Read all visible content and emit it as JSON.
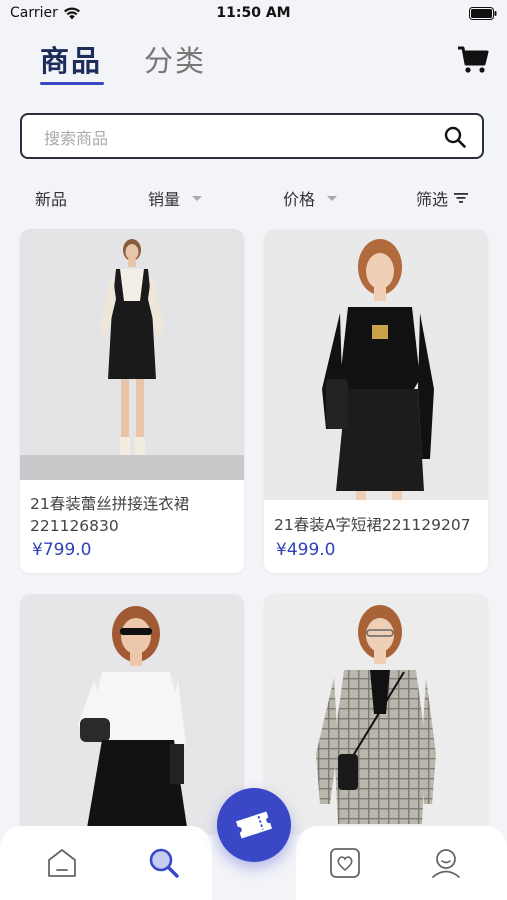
{
  "status_bar": {
    "carrier": "Carrier",
    "time": "11:50 AM"
  },
  "header": {
    "tabs": [
      {
        "label": "商品",
        "active": true
      },
      {
        "label": "分类",
        "active": false
      }
    ],
    "cart_icon": "cart-icon"
  },
  "search": {
    "placeholder": "搜索商品",
    "value": ""
  },
  "filters": [
    {
      "label": "新品"
    },
    {
      "label": "销量",
      "indicator": "caret-down"
    },
    {
      "label": "价格",
      "indicator": "caret-down"
    },
    {
      "label": "筛选",
      "indicator": "filter-icon"
    }
  ],
  "products": [
    {
      "name": "21春装蕾丝拼接连衣裙221126830",
      "price": "¥799.0"
    },
    {
      "name": "21春装A字短裙221129207",
      "price": "¥499.0"
    },
    {
      "name": "",
      "price": ""
    },
    {
      "name": "",
      "price": ""
    }
  ],
  "bottom_nav": [
    {
      "icon": "home-icon",
      "active": false
    },
    {
      "icon": "search-icon",
      "active": true
    },
    {
      "icon": "ticket-icon",
      "active": false
    },
    {
      "icon": "favorites-icon",
      "active": false
    },
    {
      "icon": "profile-icon",
      "active": false
    }
  ],
  "colors": {
    "accent": "#3a48c8",
    "price": "#3242b5",
    "background": "#f3f4f8"
  }
}
